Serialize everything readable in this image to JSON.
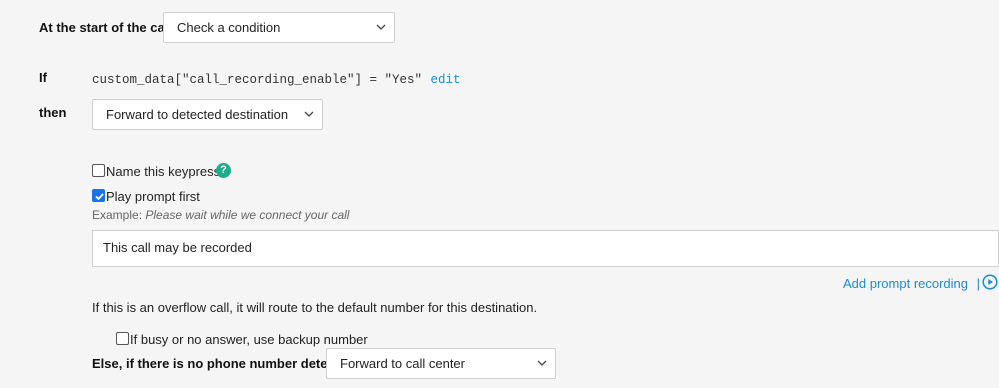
{
  "start": {
    "label": "At the start of the call",
    "select_value": "Check a condition"
  },
  "condition": {
    "if_label": "If",
    "expression": "custom_data[\"call_recording_enable\"] = \"Yes\"",
    "edit_link": "edit",
    "then_label": "then",
    "then_select_value": "Forward to detected destination"
  },
  "keypress": {
    "name_label": "Name this keypress",
    "name_checked": false,
    "help_icon": "question-icon"
  },
  "prompt": {
    "play_label": "Play prompt first",
    "play_checked": true,
    "example_prefix": "Example:",
    "example_text": "Please wait while we connect your call",
    "prompt_text": "This call may be recorded",
    "add_recording_link": "Add prompt recording",
    "separator": "|",
    "play_icon": "play-circle-icon"
  },
  "overflow": {
    "note": "If this is an overflow call, it will route to the default number for this destination.",
    "backup_label": "If busy or no answer, use backup number",
    "backup_checked": false
  },
  "else": {
    "label": "Else, if there is no phone number detected",
    "select_value": "Forward to call center"
  },
  "colors": {
    "background": "#f5f5f5",
    "link": "#1a8ccf",
    "checkbox_checked": "#1a73e8",
    "help_icon": "#1aae8b"
  }
}
